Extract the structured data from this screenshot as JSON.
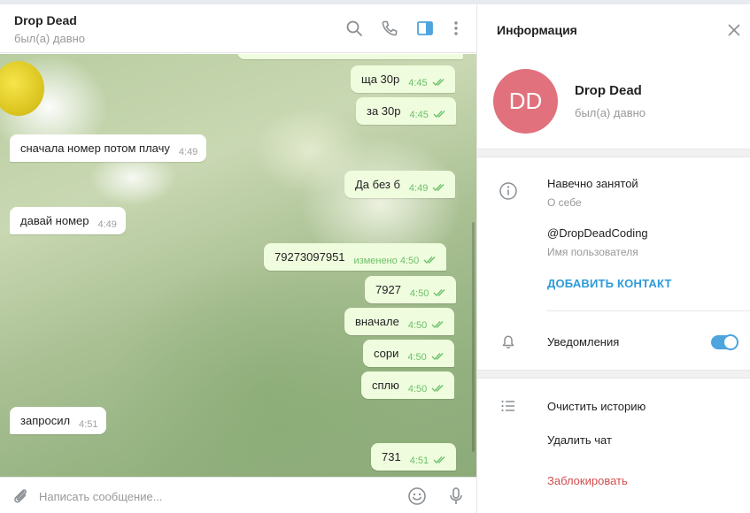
{
  "chat": {
    "title": "Drop Dead",
    "status": "был(а) давно",
    "messages": [
      {
        "direction": "out",
        "text": "ща 30р",
        "time": "4:45"
      },
      {
        "direction": "out",
        "text": "за 30р",
        "time": "4:45"
      },
      {
        "direction": "in",
        "text": "сначала номер потом плачу",
        "time": "4:49"
      },
      {
        "direction": "out",
        "text": "Да без б",
        "time": "4:49"
      },
      {
        "direction": "in",
        "text": "давай номер",
        "time": "4:49"
      },
      {
        "direction": "out",
        "text": "79273097951",
        "time": "изменено 4:50"
      },
      {
        "direction": "out",
        "text": "7927",
        "time": "4:50"
      },
      {
        "direction": "out",
        "text": "вначале",
        "time": "4:50"
      },
      {
        "direction": "out",
        "text": "сори",
        "time": "4:50"
      },
      {
        "direction": "out",
        "text": "сплю",
        "time": "4:50"
      },
      {
        "direction": "in",
        "text": "запросил",
        "time": "4:51"
      },
      {
        "direction": "out",
        "text": "731",
        "time": "4:51"
      }
    ],
    "composer_placeholder": "Написать сообщение..."
  },
  "info": {
    "title": "Информация",
    "avatar_initials": "DD",
    "avatar_color": "#e0717d",
    "name": "Drop Dead",
    "status": "был(а) давно",
    "bio": "Навечно занятой",
    "bio_label": "О себе",
    "username": "@DropDeadCoding",
    "username_label": "Имя пользователя",
    "add_contact": "ДОБАВИТЬ КОНТАКТ",
    "notifications": "Уведомления",
    "notifications_on": true,
    "clear_history": "Очистить историю",
    "delete_chat": "Удалить чат",
    "block": "Заблокировать"
  },
  "colors": {
    "accent": "#4ea4dd",
    "link": "#2d9ad8",
    "danger": "#d14e4e",
    "outgoing_bubble": "#effdde",
    "read_ticks": "#6cbf6a"
  }
}
